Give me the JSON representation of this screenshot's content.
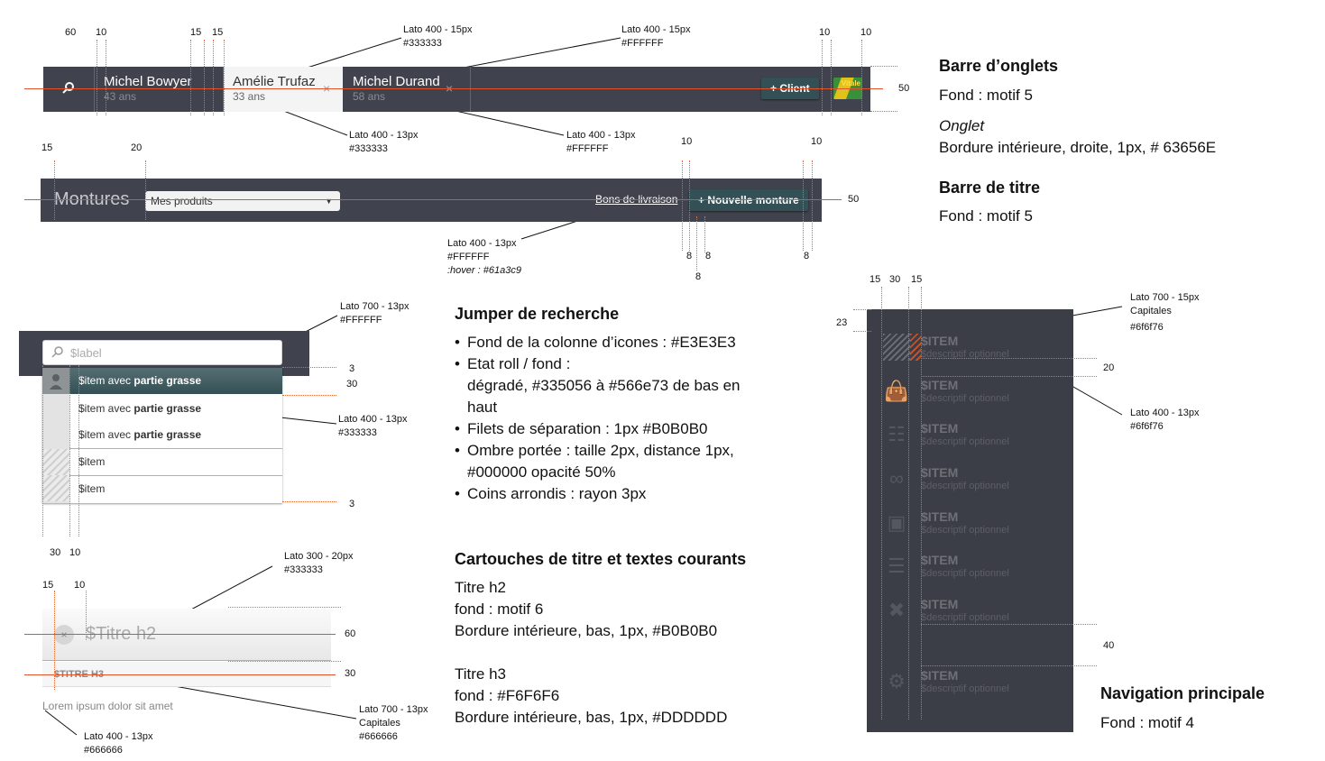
{
  "tabbar": {
    "tabs": [
      {
        "name": "Michel Bowyer",
        "age": "43 ans",
        "close": "×"
      },
      {
        "name": "Amélie Trufaz",
        "age": "33 ans",
        "close": "×"
      },
      {
        "name": "Michel Durand",
        "age": "58 ans",
        "close": "×"
      }
    ],
    "client_button": "+ Client",
    "vitale_label": "Vitale",
    "search_icon": "search-icon"
  },
  "titlebar": {
    "title": "Montures",
    "select_value": "Mes produits",
    "link": "Bons de livraison",
    "new_button": "+ Nouvelle monture"
  },
  "jumper": {
    "placeholder": "$label",
    "items": [
      {
        "plain": "$item avec ",
        "bold": "partie grasse"
      },
      {
        "plain": "$item avec ",
        "bold": "partie grasse"
      },
      {
        "plain": "$item avec ",
        "bold": "partie grasse"
      },
      {
        "plain": "$item",
        "bold": ""
      },
      {
        "plain": "$item",
        "bold": ""
      }
    ]
  },
  "titles": {
    "h2": "$Titre h2",
    "h3": "$TITRE H3",
    "body": "Lorem ipsum dolor sit amet"
  },
  "nav": {
    "items": [
      {
        "label": "$ITEM",
        "desc": "$descriptif optionnel",
        "icon": "hatched-placeholder-icon"
      },
      {
        "label": "$ITEM",
        "desc": "$descriptif optionnel",
        "icon": "bag-icon"
      },
      {
        "label": "$ITEM",
        "desc": "$descriptif optionnel",
        "icon": "cash-register-icon"
      },
      {
        "label": "$ITEM",
        "desc": "$descriptif optionnel",
        "icon": "glasses-icon"
      },
      {
        "label": "$ITEM",
        "desc": "$descriptif optionnel",
        "icon": "box-icon"
      },
      {
        "label": "$ITEM",
        "desc": "$descriptif optionnel",
        "icon": "stack-icon"
      },
      {
        "label": "$ITEM",
        "desc": "$descriptif optionnel",
        "icon": "tools-icon"
      },
      {
        "label": "$ITEM",
        "desc": "$descriptif optionnel",
        "icon": "gear-icon"
      }
    ]
  },
  "annotations": {
    "lato400_15_333": [
      "Lato 400 - 15px",
      "#333333"
    ],
    "lato400_15_fff": [
      "Lato 400 - 15px",
      "#FFFFFF"
    ],
    "lato400_13_333": [
      "Lato 400 - 13px",
      "#333333"
    ],
    "lato400_13_fff": [
      "Lato 400 - 13px",
      "#FFFFFF"
    ],
    "lato400_13_fff_hover": [
      "Lato 400 - 13px",
      "#FFFFFF",
      ":hover : #61a3c9"
    ],
    "jumper_700": [
      "Lato 700 - 13px",
      "#FFFFFF"
    ],
    "jumper_400": [
      "Lato 400 - 13px",
      "#333333"
    ],
    "h2_300": [
      "Lato 300 - 20px",
      "#333333"
    ],
    "h3_700": [
      "Lato 700 - 13px",
      "Capitales",
      "#666666"
    ],
    "body_400": [
      "Lato 400 - 13px",
      "#666666"
    ],
    "nav_700": [
      "Lato 700 - 15px",
      "Capitales",
      "#6f6f76"
    ],
    "nav_400": [
      "Lato 400 - 13px",
      "#6f6f76"
    ]
  },
  "dimensions": {
    "tab_top": [
      "60",
      "10",
      "15",
      "15",
      "10",
      "10"
    ],
    "tab_height": "50",
    "title_top": [
      "15",
      "20",
      "10",
      "10"
    ],
    "title_height": "50",
    "title_bottom": [
      "8",
      "8",
      "8",
      "8"
    ],
    "jumper_right": [
      "3",
      "30",
      "3"
    ],
    "jumper_bottom": [
      "30",
      "10"
    ],
    "h2_top": [
      "15",
      "10"
    ],
    "h2_height": "60",
    "h3_height": "30",
    "nav_top": [
      "15",
      "30",
      "15"
    ],
    "nav_left": "23",
    "nav_item": "20",
    "nav_gap": "40"
  },
  "specs": {
    "tabbar_title": "Barre d’onglets",
    "tabbar_fond": "Fond : motif 5",
    "onglet_title": "Onglet",
    "onglet_text": "Bordure intérieure, droite, 1px, # 63656E",
    "titlebar_title": "Barre de titre",
    "titlebar_fond": "Fond : motif 5",
    "jumper_title": "Jumper de recherche",
    "jumper_list": [
      "Fond de la colonne d’icones : #E3E3E3",
      "Etat roll / fond :",
      "Filets de séparation : 1px #B0B0B0",
      "Ombre portée : taille 2px, distance 1px,",
      "Coins arrondis : rayon 3px"
    ],
    "jumper_list_cont1": "dégradé, #335056 à #566e73 de bas en",
    "jumper_list_cont2": "haut",
    "jumper_list_cont3": "#000000 opacité 50%",
    "cartouches_title": "Cartouches de titre et textes courants",
    "h2_lines": [
      "Titre h2",
      "fond : motif 6",
      "Bordure intérieure, bas, 1px, #B0B0B0"
    ],
    "h3_lines": [
      "Titre h3",
      "fond : #F6F6F6",
      "Bordure intérieure, bas, 1px, #DDDDDD"
    ],
    "nav_title": "Navigation principale",
    "nav_fond": "Fond : motif 4"
  }
}
